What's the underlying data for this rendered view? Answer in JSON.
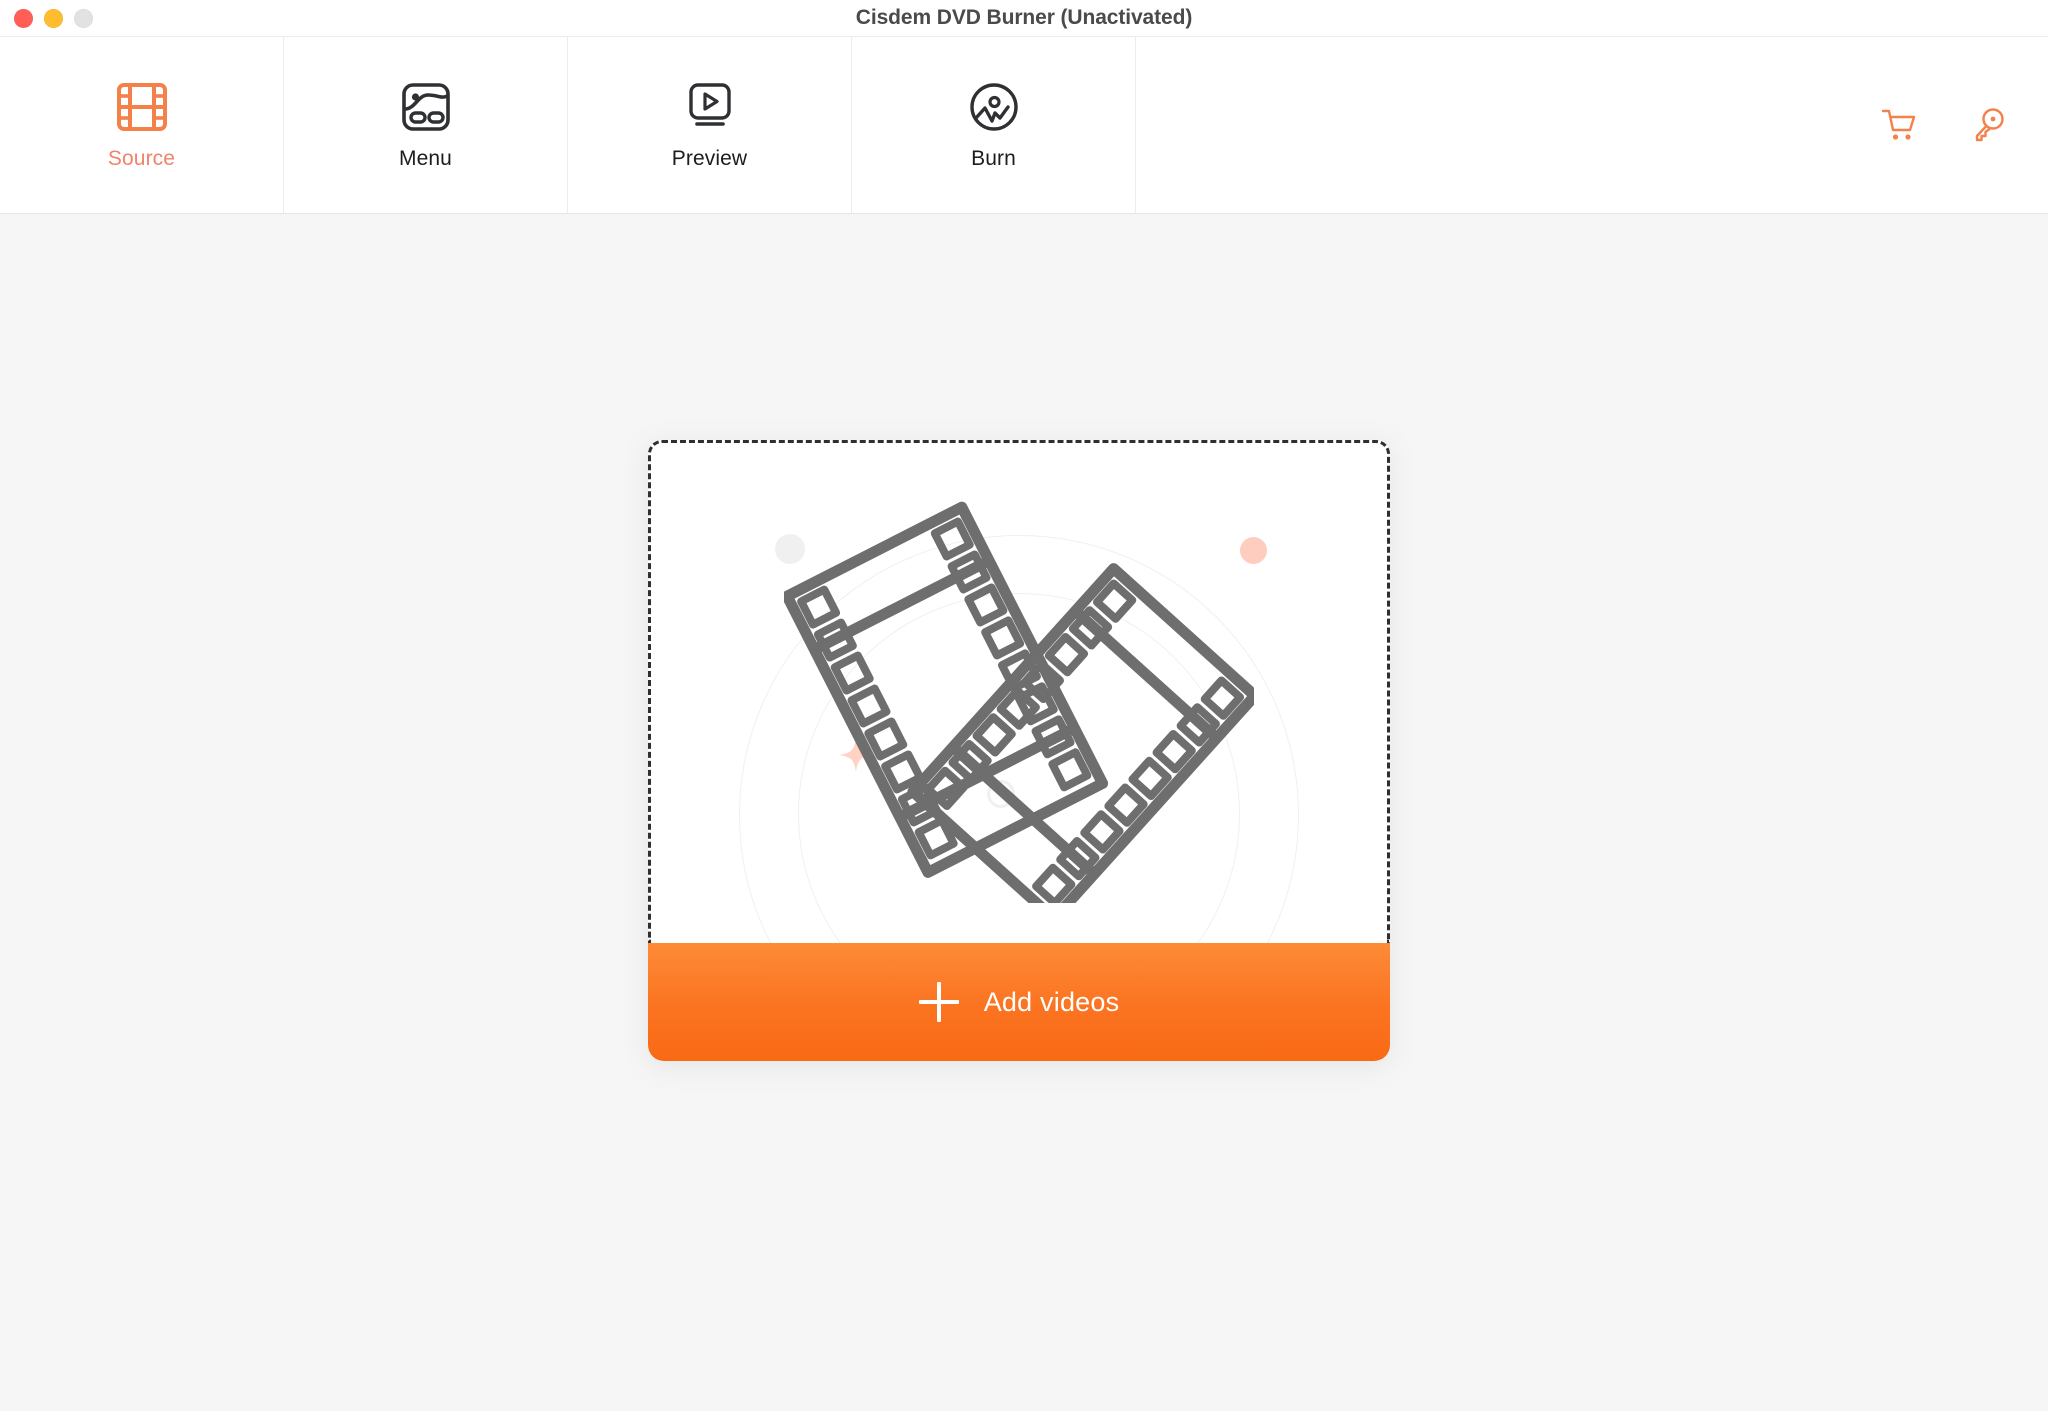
{
  "window": {
    "title": "Cisdem DVD Burner (Unactivated)",
    "traffic_lights": [
      {
        "name": "close",
        "color": "#ff5f57"
      },
      {
        "name": "minimize",
        "color": "#febc2e"
      },
      {
        "name": "zoom",
        "color": "#e2e2e2"
      }
    ]
  },
  "toolbar": {
    "tabs": [
      {
        "label": "Source",
        "icon": "film-strip-icon",
        "active": true
      },
      {
        "label": "Menu",
        "icon": "menu-template-icon",
        "active": false
      },
      {
        "label": "Preview",
        "icon": "preview-monitor-play-icon",
        "active": false
      },
      {
        "label": "Burn",
        "icon": "burn-disc-icon",
        "active": false
      }
    ],
    "actions": [
      {
        "name": "cart-icon",
        "label": "Buy"
      },
      {
        "name": "key-icon",
        "label": "Register"
      }
    ]
  },
  "main": {
    "dropzone": {
      "illustration": "two-film-strips-icon",
      "decorations": [
        "ring-outer",
        "ring-inner",
        "dot-gray",
        "dot-pink",
        "ring-small",
        "sparkle-icon"
      ]
    },
    "add_button": {
      "label": "Add videos",
      "icon": "plus-icon"
    }
  },
  "colors": {
    "accent_orange": "#fb7321",
    "active_tab_text": "#f4816a",
    "window_background": "#f6f6f6",
    "toolbar_background": "#ffffff",
    "dashed_border": "#2f2f2f",
    "illustration_gray": "#6e6e6e",
    "decor_pink": "#ffcdc0"
  }
}
